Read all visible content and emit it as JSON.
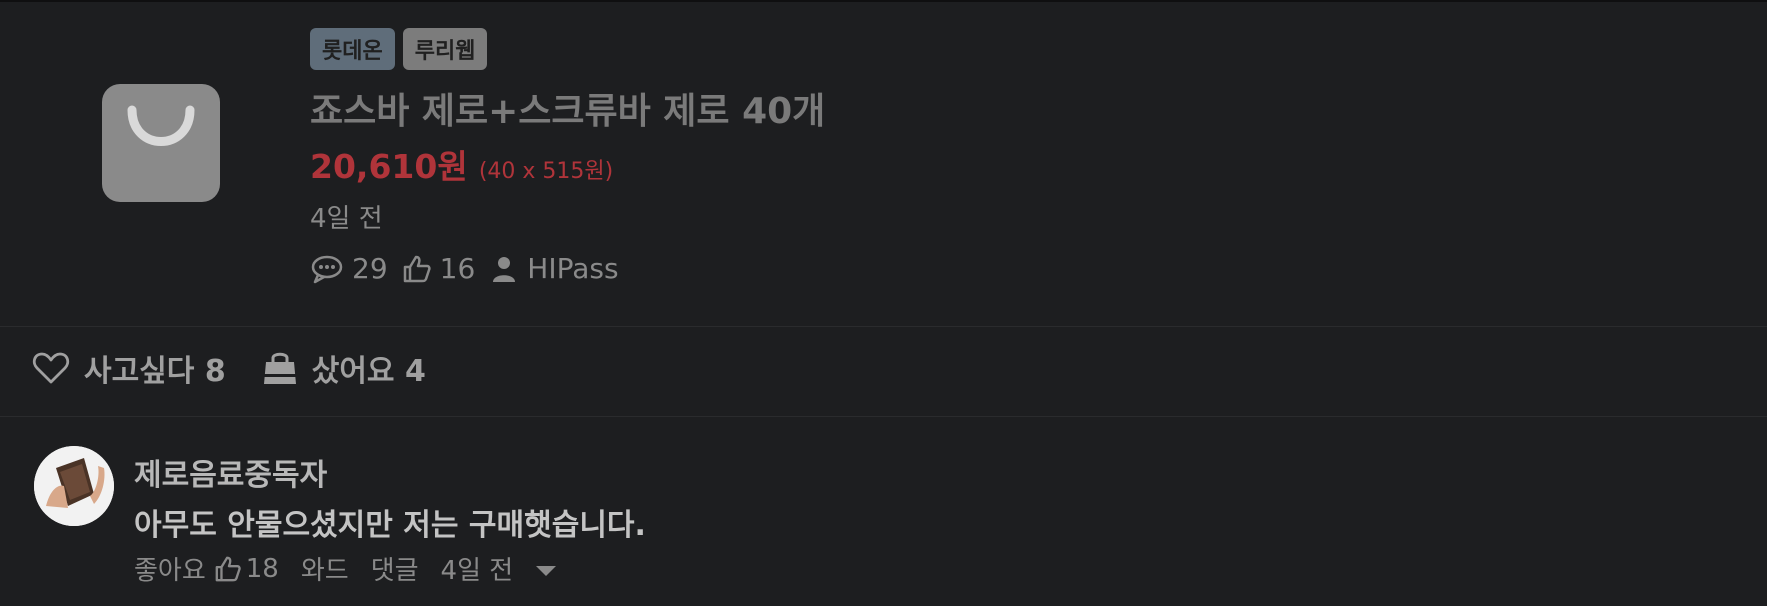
{
  "deal": {
    "badges": [
      "롯데온",
      "루리웹"
    ],
    "title": "죠스바 제로+스크류바 제로 40개",
    "price": "20,610원",
    "unit_price": "(40 x 515원)",
    "posted": "4일 전",
    "comments_count": "29",
    "likes_count": "16",
    "author": "HIPass"
  },
  "actions": {
    "want_label": "사고싶다 8",
    "bought_label": "샀어요 4"
  },
  "comment": {
    "author": "제로음료중독자",
    "text": "아무도 안물으셨지만 저는 구매햇습니다.",
    "like_label": "좋아요",
    "like_count": "18",
    "wad_label": "와드",
    "reply_label": "댓글",
    "time": "4일 전"
  },
  "colors": {
    "background": "#1d1e20",
    "price": "#b0343a",
    "store_badge": "#5f6d7a",
    "card_badge": "#7c7c7c"
  },
  "icons": [
    "shopping-bag-icon",
    "comment-icon",
    "thumbs-up-icon",
    "user-icon",
    "heart-icon",
    "bag-icon",
    "dropdown-caret-icon"
  ]
}
